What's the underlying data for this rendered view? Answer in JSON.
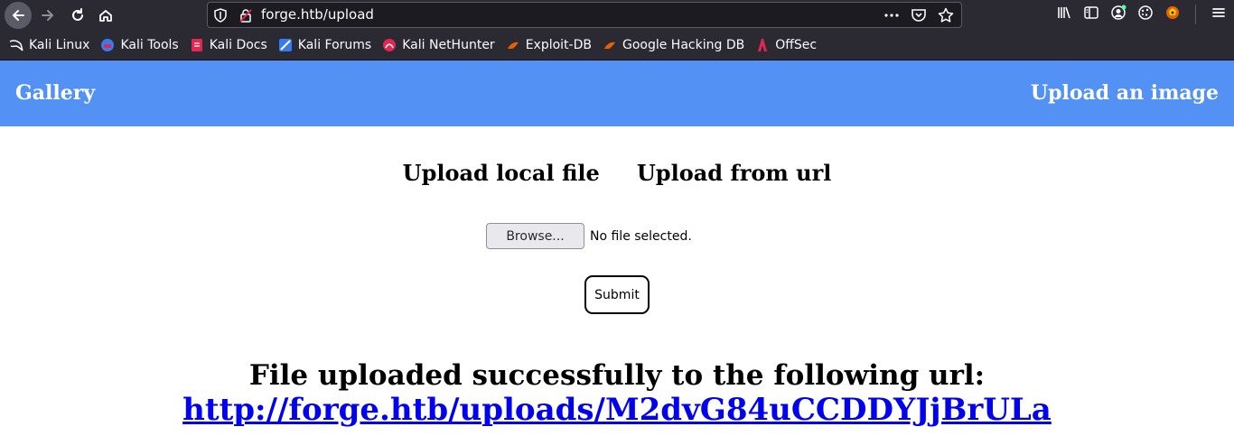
{
  "browser": {
    "url": "forge.htb/upload",
    "bookmarks": [
      {
        "label": "Kali Linux",
        "icon": "kali-dragon-icon"
      },
      {
        "label": "Kali Tools",
        "icon": "kali-tools-icon"
      },
      {
        "label": "Kali Docs",
        "icon": "kali-docs-icon"
      },
      {
        "label": "Kali Forums",
        "icon": "kali-forums-icon"
      },
      {
        "label": "Kali NetHunter",
        "icon": "nethunter-icon"
      },
      {
        "label": "Exploit-DB",
        "icon": "exploit-db-icon"
      },
      {
        "label": "Google Hacking DB",
        "icon": "ghdb-icon"
      },
      {
        "label": "OffSec",
        "icon": "offsec-icon"
      }
    ]
  },
  "header": {
    "title": "Gallery",
    "upload_link": "Upload an image",
    "color": "#5391f5"
  },
  "upload": {
    "tab_local": "Upload local file",
    "tab_url": "Upload from url",
    "browse_label": "Browse...",
    "file_status": "No file selected.",
    "submit_label": "Submit"
  },
  "result": {
    "message": "File uploaded successfully to the following url:",
    "link": "http://forge.htb/uploads/M2dvG84uCCDDYJjBrULa"
  }
}
